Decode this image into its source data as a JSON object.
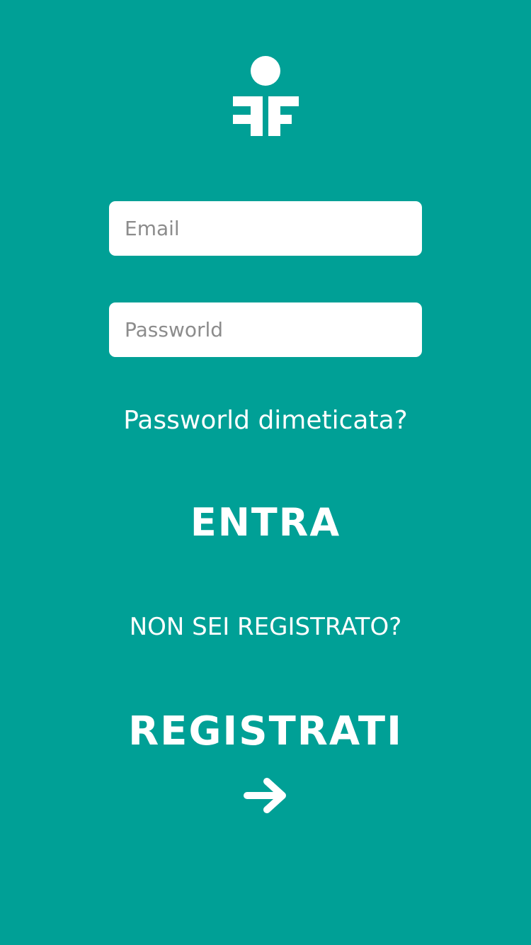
{
  "login": {
    "email_placeholder": "Email",
    "password_placeholder": "Passworld",
    "forgot_password": "Passworld dimeticata?",
    "enter_button": "ENTRA",
    "not_registered": "NON SEI REGISTRATO?",
    "register_button": "REGISTRATI"
  },
  "icons": {
    "logo": "ff-person-logo",
    "register_arrow": "arrow-right-icon"
  },
  "colors": {
    "background": "#00A096",
    "foreground": "#FFFFFF",
    "input_background": "#FFFFFF",
    "placeholder": "#8C8C8C"
  }
}
